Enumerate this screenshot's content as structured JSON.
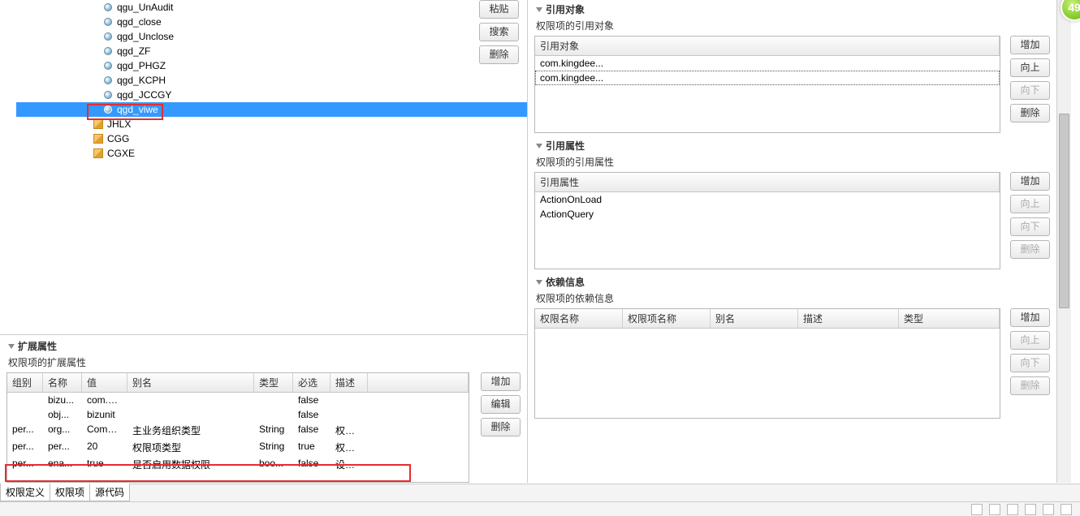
{
  "corner_badge": "49",
  "left": {
    "tree": [
      {
        "icon": "sphere",
        "label": "qgu_UnAudit",
        "indent": 2
      },
      {
        "icon": "sphere",
        "label": "qgd_close",
        "indent": 2
      },
      {
        "icon": "sphere",
        "label": "qgd_Unclose",
        "indent": 2
      },
      {
        "icon": "sphere",
        "label": "qgd_ZF",
        "indent": 2
      },
      {
        "icon": "sphere",
        "label": "qgd_PHGZ",
        "indent": 2
      },
      {
        "icon": "sphere",
        "label": "qgd_KCPH",
        "indent": 2
      },
      {
        "icon": "sphere",
        "label": "qgd_JCCGY",
        "indent": 2
      },
      {
        "icon": "sphere",
        "label": "qgd_viwe",
        "indent": 2,
        "selected": true
      },
      {
        "icon": "cube",
        "label": "JHLX",
        "indent": 1
      },
      {
        "icon": "cube",
        "label": "CGG",
        "indent": 1
      },
      {
        "icon": "cube",
        "label": "CGXE",
        "indent": 1
      }
    ],
    "side_buttons": [
      "粘贴",
      "搜索",
      "删除"
    ],
    "ext_title": "扩展属性",
    "ext_sub": "权限项的扩展属性",
    "ext_headers": [
      "组别",
      "名称",
      "值",
      "别名",
      "类型",
      "必选",
      "描述"
    ],
    "ext_rows": [
      [
        "",
        "bizu...",
        "com.ki...",
        "",
        "",
        "false",
        ""
      ],
      [
        "",
        "obj...",
        "bizunit",
        "",
        "",
        "false",
        ""
      ],
      [
        "per...",
        "org...",
        "Compa...",
        "主业务组织类型",
        "String",
        "false",
        "权限..."
      ],
      [
        "per...",
        "per...",
        "20",
        "权限项类型",
        "String",
        "true",
        "权限..."
      ],
      [
        "per...",
        "ena...",
        "true",
        "是否启用数据权限",
        "boo...",
        "false",
        "设置..."
      ]
    ],
    "ext_buttons": [
      "增加",
      "编辑",
      "删除"
    ]
  },
  "right": {
    "obj_title": "引用对象",
    "obj_sub": "权限项的引用对象",
    "obj_header": "引用对象",
    "obj_rows": [
      "com.kingdee...",
      "com.kingdee..."
    ],
    "obj_buttons": [
      "增加",
      "向上",
      "向下",
      "删除"
    ],
    "attr_title": "引用属性",
    "attr_sub": "权限项的引用属性",
    "attr_header": "引用属性",
    "attr_rows": [
      "ActionOnLoad",
      "ActionQuery"
    ],
    "attr_buttons": [
      "增加",
      "向上",
      "向下",
      "删除"
    ],
    "dep_title": "依赖信息",
    "dep_sub": "权限项的依赖信息",
    "dep_headers": [
      "权限名称",
      "权限项名称",
      "别名",
      "描述",
      "类型"
    ],
    "dep_buttons": [
      "增加",
      "向上",
      "向下",
      "删除"
    ]
  },
  "tabs": [
    "权限定义",
    "权限项",
    "源代码"
  ]
}
